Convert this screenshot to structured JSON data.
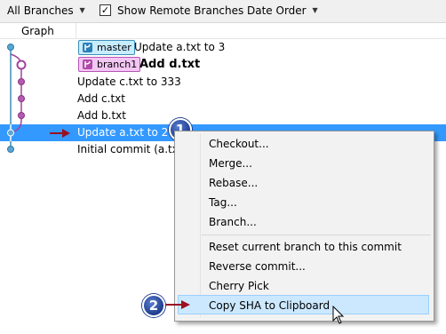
{
  "toolbar": {
    "branches_label": "All Branches",
    "show_remote_label": "Show Remote Branches",
    "show_remote_checked": true,
    "order_label": "Date Order"
  },
  "header": {
    "graph_label": "Graph"
  },
  "commits": [
    {
      "message": "Update a.txt to 3",
      "tag": "master",
      "tag_kind": "local-remote"
    },
    {
      "message": "Add d.txt",
      "tag": "branch1",
      "tag_kind": "local-remote"
    },
    {
      "message": "Update c.txt to 333"
    },
    {
      "message": "Add c.txt"
    },
    {
      "message": "Add b.txt"
    },
    {
      "message": "Update a.txt to 2",
      "selected": true
    },
    {
      "message": "Initial commit (a.txt"
    }
  ],
  "context_menu": {
    "items": [
      "Checkout...",
      "Merge...",
      "Rebase...",
      "Tag...",
      "Branch..."
    ],
    "items2": [
      "Reset current branch to this commit",
      "Reverse commit...",
      "Cherry Pick",
      "Copy SHA to Clipboard"
    ],
    "highlighted": "Copy SHA to Clipboard"
  },
  "callouts": [
    "1",
    "2"
  ],
  "colors": {
    "selection": "#3399ff",
    "master_line": "#3a8fb7",
    "branch_line": "#a0449e",
    "arrow": "#9b1020",
    "menu_hover": "#cce8ff"
  }
}
